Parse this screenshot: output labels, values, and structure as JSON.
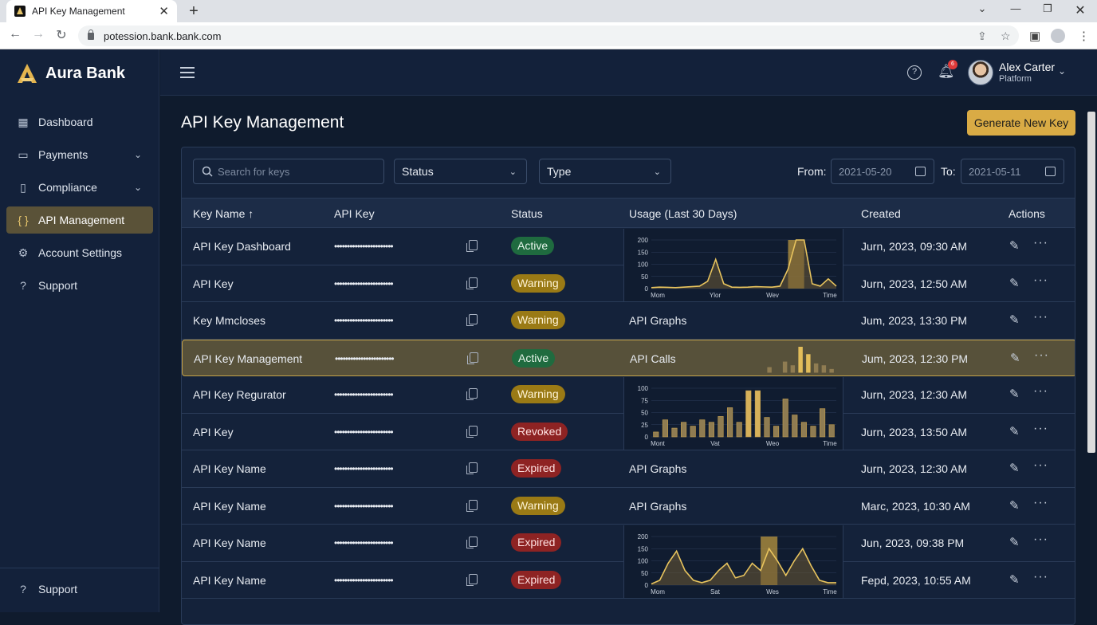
{
  "browser": {
    "tab_title": "API Key Management",
    "url": "potession.bank.bank.com"
  },
  "sidebar": {
    "brand": "Aura Bank",
    "items": [
      {
        "label": "Dashboard",
        "icon": "grid-icon",
        "has_chevron": false,
        "active": false
      },
      {
        "label": "Payments",
        "icon": "card-icon",
        "has_chevron": true,
        "active": false
      },
      {
        "label": "Compliance",
        "icon": "document-icon",
        "has_chevron": true,
        "active": false
      },
      {
        "label": "API Management",
        "icon": "braces-icon",
        "has_chevron": false,
        "active": true
      },
      {
        "label": "Account Settings",
        "icon": "gear-icon",
        "has_chevron": false,
        "active": false
      },
      {
        "label": "Support",
        "icon": "help-icon",
        "has_chevron": false,
        "active": false
      }
    ],
    "bottom_item": "Support"
  },
  "topbar": {
    "notification_count": "6",
    "user_name": "Alex Carter",
    "user_role": "Platform"
  },
  "page": {
    "title": "API Key Management",
    "generate_button": "Generate New Key"
  },
  "filters": {
    "search_placeholder": "Search for keys",
    "status_label": "Status",
    "type_label": "Type",
    "from_label": "From:",
    "from_value": "2021-05-20",
    "to_label": "To:",
    "to_value": "2021-05-11"
  },
  "table": {
    "headers": {
      "name": "Key Name",
      "key": "API Key",
      "status": "Status",
      "usage": "Usage (Last 30 Days)",
      "created": "Created",
      "actions": "Actions"
    },
    "rows": [
      {
        "name": "API Key Dashboard",
        "key": "•••••••••••••••••••••••",
        "status": "Active",
        "usage": "",
        "created": "Jurn, 2023, 09:30 AM"
      },
      {
        "name": "API Key",
        "key": "•••••••••••••••••••••••",
        "status": "Warning",
        "usage": "",
        "created": "Jurn, 2023, 12:50 AM"
      },
      {
        "name": "Key Mmcloses",
        "key": "•••••••••••••••••••••••",
        "status": "Warning",
        "usage": "API  Graphs",
        "created": "Jum, 2023, 13:30 PM"
      },
      {
        "name": "API Key Management",
        "key": "•••••••••••••••••••••••",
        "status": "Active",
        "usage": "API Calls",
        "created": "Jum, 2023, 12:30 PM"
      },
      {
        "name": "API Key Regurator",
        "key": "•••••••••••••••••••••••",
        "status": "Warning",
        "usage": "",
        "created": "Jurn, 2023, 12:30 AM"
      },
      {
        "name": "API Key",
        "key": "•••••••••••••••••••••••",
        "status": "Revoked",
        "usage": "",
        "created": "Jurn, 2023, 13:50 AM"
      },
      {
        "name": "API Key Name",
        "key": "•••••••••••••••••••••••",
        "status": "Expired",
        "usage": "API  Graphs",
        "created": "Jurn, 2023, 12:30 AM"
      },
      {
        "name": "API Key Name",
        "key": "•••••••••••••••••••••••",
        "status": "Warning",
        "usage": "API  Graphs",
        "created": "Marc, 2023, 10:30 AM"
      },
      {
        "name": "API Key Name",
        "key": "•••••••••••••••••••••••",
        "status": "Expired",
        "usage": "",
        "created": "Jun, 2023, 09:38 PM"
      },
      {
        "name": "API Key Name",
        "key": "•••••••••••••••••••••••",
        "status": "Expired",
        "usage": "",
        "created": "Fepd, 2023, 10:55 AM"
      }
    ]
  },
  "usage_charts": [
    {
      "type": "area",
      "rows": [
        1,
        2
      ],
      "yticks": [
        200,
        150,
        100,
        50,
        0
      ],
      "xticks": [
        "Mom",
        "Ylor",
        "Wev",
        "Time"
      ],
      "values": [
        4,
        6,
        5,
        4,
        6,
        8,
        10,
        30,
        120,
        20,
        6,
        5,
        6,
        8,
        7,
        6,
        10,
        80,
        200,
        200,
        20,
        10,
        40,
        10
      ],
      "highlight_range": [
        17,
        19
      ]
    },
    {
      "type": "bar",
      "rows": [
        4
      ],
      "values": [
        0,
        0,
        0,
        0,
        0,
        0,
        0,
        3,
        0,
        6,
        4,
        14,
        10,
        5,
        4,
        2
      ]
    },
    {
      "type": "bar",
      "rows": [
        5,
        6
      ],
      "yticks": [
        100,
        75,
        50,
        25,
        0
      ],
      "xticks": [
        "Mont",
        "Vat",
        "Weo",
        "Time"
      ],
      "values": [
        10,
        35,
        18,
        30,
        22,
        35,
        30,
        42,
        60,
        30,
        95,
        95,
        40,
        22,
        78,
        45,
        30,
        22,
        58,
        25
      ],
      "highlight_range": [
        10,
        11
      ]
    },
    {
      "type": "area",
      "rows": [
        9,
        10
      ],
      "yticks": [
        200,
        150,
        100,
        50,
        0
      ],
      "xticks": [
        "Mom",
        "Sat",
        "Wes",
        "Time"
      ],
      "values": [
        5,
        20,
        90,
        140,
        60,
        20,
        10,
        20,
        60,
        90,
        30,
        40,
        90,
        60,
        150,
        100,
        40,
        100,
        150,
        80,
        20,
        10,
        10
      ],
      "highlight_range": [
        13,
        15
      ]
    }
  ],
  "colors": {
    "accent": "#d9ab45",
    "background": "#0f1b2d",
    "sidebar": "#13213a",
    "active_status": "#1f6b3f",
    "warning_status": "#9a7a15",
    "danger_status": "#8e2323"
  }
}
